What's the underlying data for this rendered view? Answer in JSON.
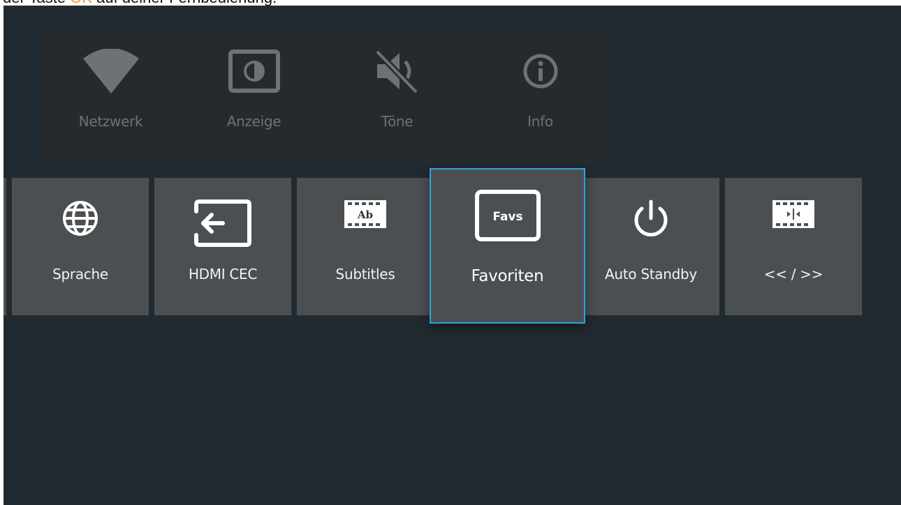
{
  "caption": {
    "before": "der Taste ",
    "highlight": "OK",
    "after": " auf deiner Fernbedienung."
  },
  "colors": {
    "background": "#222a31",
    "tile_dim": "#262a2c",
    "tile": "#4b4f52",
    "focus_border": "#2ba3e0",
    "highlight": "#f29b1d"
  },
  "top_row": [
    {
      "label": "Netzwerk",
      "icon": "wifi-icon"
    },
    {
      "label": "Anzeige",
      "icon": "display-brightness-icon"
    },
    {
      "label": "Töne",
      "icon": "speaker-mute-icon"
    },
    {
      "label": "Info",
      "icon": "info-icon"
    }
  ],
  "bottom_row": [
    {
      "label": "Sprache",
      "icon": "globe-icon"
    },
    {
      "label": "HDMI CEC",
      "icon": "input-source-icon"
    },
    {
      "label": "Subtitles",
      "icon": "subtitles-film-icon",
      "icon_text": "Ab"
    },
    {
      "label": "Favoriten",
      "icon": "favorites-tv-icon",
      "icon_text": "Favs",
      "selected": true
    },
    {
      "label": "Auto Standby",
      "icon": "power-icon"
    },
    {
      "label": "<< / >>",
      "icon": "skip-film-icon"
    }
  ]
}
